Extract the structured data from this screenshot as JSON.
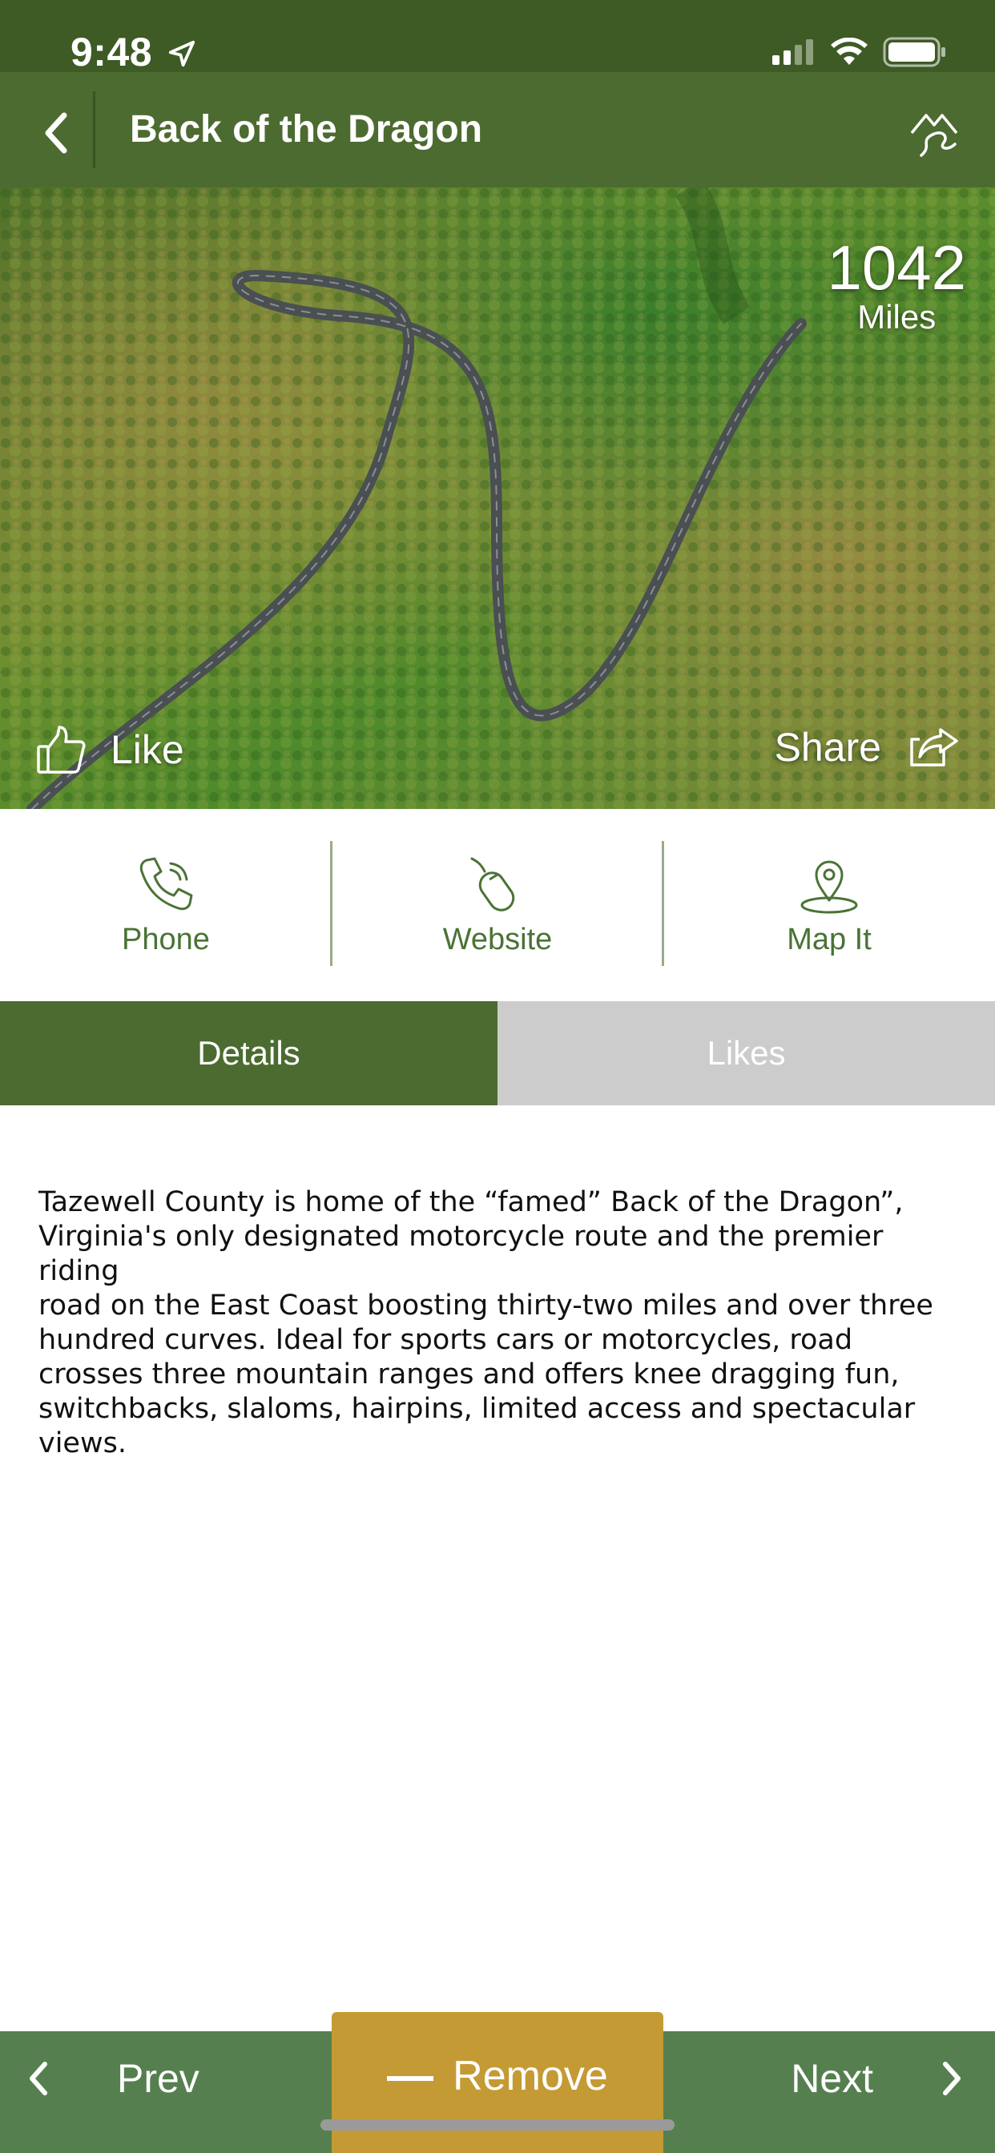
{
  "status_bar": {
    "time": "9:48",
    "icons": [
      "location-arrow-icon",
      "cellular-signal-icon",
      "wifi-icon",
      "battery-icon"
    ]
  },
  "header": {
    "title": "Back of the Dragon",
    "back_icon": "chevron-left-icon",
    "action_icon": "route-mountain-icon"
  },
  "hero": {
    "miles_value": "1042",
    "miles_label": "Miles",
    "like_label": "Like",
    "share_label": "Share"
  },
  "actions": [
    {
      "label": "Phone",
      "icon": "phone-icon"
    },
    {
      "label": "Website",
      "icon": "mouse-icon"
    },
    {
      "label": "Map It",
      "icon": "map-pin-icon"
    }
  ],
  "tabs": {
    "details": "Details",
    "likes": "Likes",
    "active": "Details"
  },
  "description": "Tazewell County is home of the “famed” Back of the Dragon”,\nVirginia's only designated motorcycle route and the premier riding\nroad on the East Coast boosting thirty-two miles and over three\nhundred curves.  Ideal for sports cars or motorcycles,  road\ncrosses three mountain ranges and offers knee dragging fun,\nswitchbacks, slaloms, hairpins, limited access and spectacular\nviews.",
  "bottom_bar": {
    "prev_label": "Prev",
    "remove_label": "Remove",
    "next_label": "Next"
  },
  "colors": {
    "header_green": "#4c6b30",
    "status_green": "#3e5a25",
    "tab_active": "#4c6b30",
    "tab_inactive": "#cccccc",
    "bottom_green": "#557f4f",
    "remove_gold": "#c49a34",
    "action_green": "#4a7335"
  }
}
